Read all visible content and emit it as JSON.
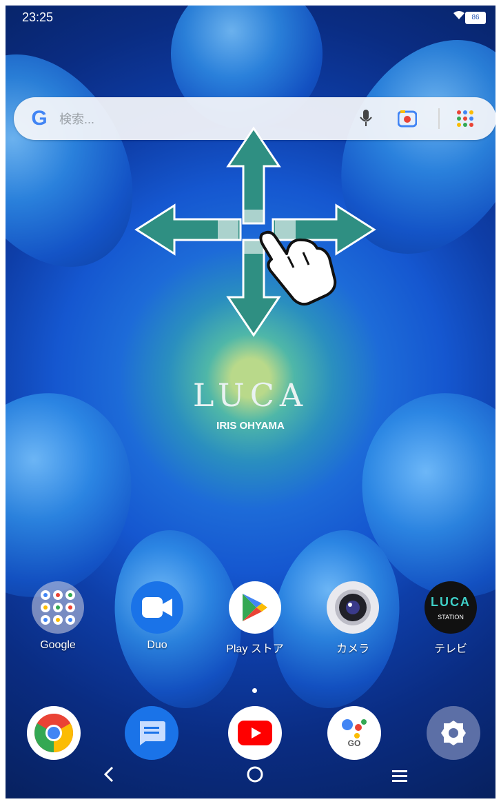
{
  "status_bar": {
    "time": "23:25",
    "battery": "86"
  },
  "search": {
    "logo": "G",
    "placeholder": "検索..."
  },
  "wallpaper": {
    "brand": "LUCA",
    "brand_sub": "IRIS OHYAMA"
  },
  "apps": [
    {
      "label": "Google",
      "icon": "google-folder-icon"
    },
    {
      "label": "Duo",
      "icon": "duo-icon"
    },
    {
      "label": "Play ストア",
      "icon": "play-store-icon"
    },
    {
      "label": "カメラ",
      "icon": "camera-icon"
    },
    {
      "label": "テレビ",
      "icon": "luca-station-icon",
      "icon_text": "LUCA",
      "icon_sub": "STATION"
    }
  ],
  "dock": [
    {
      "icon": "chrome-icon"
    },
    {
      "icon": "messages-icon"
    },
    {
      "icon": "youtube-icon"
    },
    {
      "icon": "assistant-go-icon",
      "icon_text": "GO"
    },
    {
      "icon": "settings-icon"
    }
  ],
  "colors": {
    "arrow_fill": "#2f8f82",
    "arrow_stroke": "#ffffff",
    "accent_blue": "#1a73e8"
  }
}
